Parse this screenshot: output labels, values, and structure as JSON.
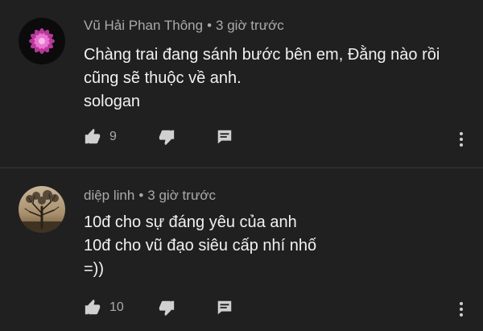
{
  "comments": [
    {
      "author": "Vũ Hải Phan Thông",
      "separator": "•",
      "time": "3 giờ trước",
      "lines": [
        "Chàng trai đang sánh bước bên em, Đằng nào rồi",
        "cũng sẽ thuộc về anh.",
        "sologan"
      ],
      "likes": "9",
      "avatar_icon": "pink-flower-avatar"
    },
    {
      "author": "diệp linh",
      "separator": "•",
      "time": "3 giờ trước",
      "lines": [
        "10đ cho sự đáng yêu của anh",
        "10đ cho vũ đạo siêu cấp nhí nhố",
        "=))"
      ],
      "likes": "10",
      "avatar_icon": "tree-sunset-avatar"
    }
  ],
  "colors": {
    "background": "#202020",
    "text": "#f1f1f1",
    "meta": "#aaaaaa",
    "icon": "#d0d0d0"
  }
}
